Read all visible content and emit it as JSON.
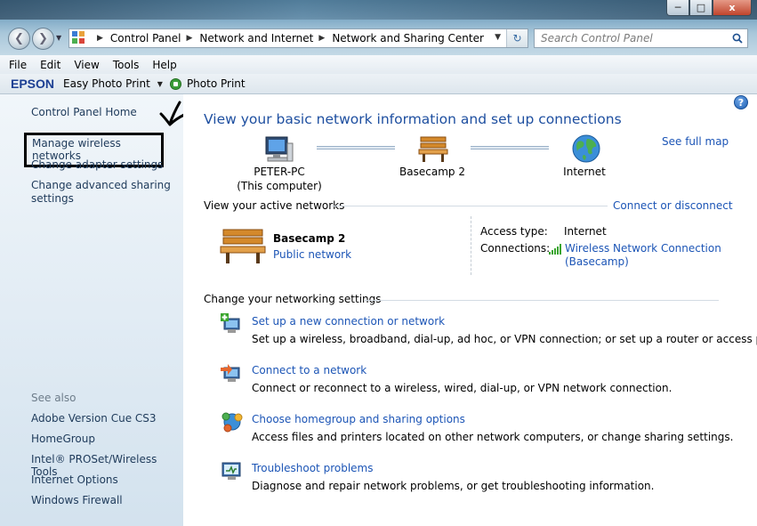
{
  "window": {
    "min_icon": "minimize-icon",
    "max_icon": "maximize-icon",
    "close_label": "x"
  },
  "nav": {
    "back_icon": "back-arrow-icon",
    "forward_icon": "forward-arrow-icon",
    "breadcrumbs": [
      "Control Panel",
      "Network and Internet",
      "Network and Sharing Center"
    ],
    "search_placeholder": "Search Control Panel"
  },
  "menu": [
    "File",
    "Edit",
    "View",
    "Tools",
    "Help"
  ],
  "toolbar": {
    "brand": "EPSON",
    "easy_photo_print": "Easy Photo Print",
    "photo_print": "Photo Print"
  },
  "sidebar": {
    "home": "Control Panel Home",
    "links": [
      "Manage wireless networks",
      "Change adapter settings",
      "Change advanced sharing settings"
    ],
    "see_also_label": "See also",
    "see_also": [
      "Adobe Version Cue CS3",
      "HomeGroup",
      "Intel® PROSet/Wireless Tools",
      "Internet Options",
      "Windows Firewall"
    ]
  },
  "main": {
    "title": "View your basic network information and set up connections",
    "see_full_map": "See full map",
    "map": {
      "computer_name": "PETER-PC",
      "computer_sub": "(This computer)",
      "network_name": "Basecamp  2",
      "internet": "Internet"
    },
    "active_networks": {
      "header": "View your active networks",
      "connect_link": "Connect or disconnect",
      "network_name": "Basecamp  2",
      "network_type": "Public network",
      "access_type_label": "Access type:",
      "access_type_value": "Internet",
      "connections_label": "Connections:",
      "connection_line1": "Wireless Network Connection",
      "connection_line2": "(Basecamp)"
    },
    "settings": {
      "header": "Change your networking settings",
      "tasks": [
        {
          "title": "Set up a new connection or network",
          "desc": "Set up a wireless, broadband, dial-up, ad hoc, or VPN connection; or set up a router or access point.",
          "icon": "new-connection-icon"
        },
        {
          "title": "Connect to a network",
          "desc": "Connect or reconnect to a wireless, wired, dial-up, or VPN network connection.",
          "icon": "connect-network-icon"
        },
        {
          "title": "Choose homegroup and sharing options",
          "desc": "Access files and printers located on other network computers, or change sharing settings.",
          "icon": "homegroup-icon"
        },
        {
          "title": "Troubleshoot problems",
          "desc": "Diagnose and repair network problems, or get troubleshooting information.",
          "icon": "troubleshoot-icon"
        }
      ]
    }
  }
}
